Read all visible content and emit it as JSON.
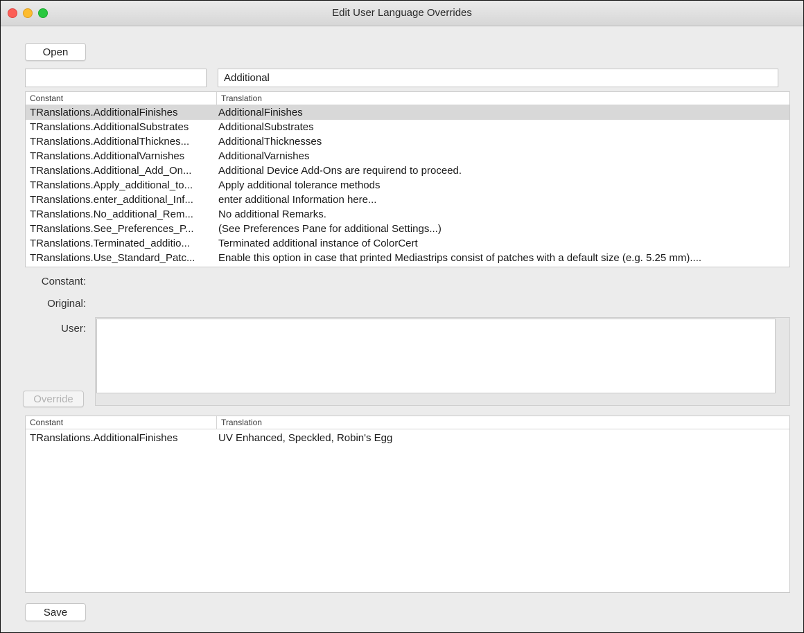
{
  "window": {
    "title": "Edit User Language Overrides"
  },
  "toolbar": {
    "open_label": "Open",
    "save_label": "Save",
    "override_label": "Override"
  },
  "filters": {
    "constant_value": "",
    "translation_value": "Additional"
  },
  "search_table": {
    "columns": [
      "Constant",
      "Translation"
    ],
    "rows": [
      {
        "constant": "TRanslations.AdditionalFinishes",
        "translation": "AdditionalFinishes",
        "selected": true
      },
      {
        "constant": "TRanslations.AdditionalSubstrates",
        "translation": "AdditionalSubstrates"
      },
      {
        "constant": "TRanslations.AdditionalThicknes...",
        "translation": "AdditionalThicknesses"
      },
      {
        "constant": "TRanslations.AdditionalVarnishes",
        "translation": "AdditionalVarnishes"
      },
      {
        "constant": "TRanslations.Additional_Add_On...",
        "translation": "Additional Device Add-Ons are requirend to proceed."
      },
      {
        "constant": "TRanslations.Apply_additional_to...",
        "translation": "Apply additional tolerance methods"
      },
      {
        "constant": "TRanslations.enter_additional_Inf...",
        "translation": "enter additional Information here..."
      },
      {
        "constant": "TRanslations.No_additional_Rem...",
        "translation": "No additional Remarks."
      },
      {
        "constant": "TRanslations.See_Preferences_P...",
        "translation": "(See Preferences Pane for additional Settings...)"
      },
      {
        "constant": "TRanslations.Terminated_additio...",
        "translation": "Terminated additional instance of ColorCert"
      },
      {
        "constant": "TRanslations.Use_Standard_Patc...",
        "translation": "Enable this option in case that printed Mediastrips consist of patches with a default size (e.g. 5.25 mm)...."
      }
    ]
  },
  "detail": {
    "constant_label": "Constant:",
    "original_label": "Original:",
    "user_label": "User:",
    "constant_value": "",
    "original_value": "",
    "user_value": ""
  },
  "overrides_table": {
    "columns": [
      "Constant",
      "Translation"
    ],
    "rows": [
      {
        "constant": "TRanslations.AdditionalFinishes",
        "translation": "UV Enhanced, Speckled, Robin's Egg"
      }
    ]
  }
}
